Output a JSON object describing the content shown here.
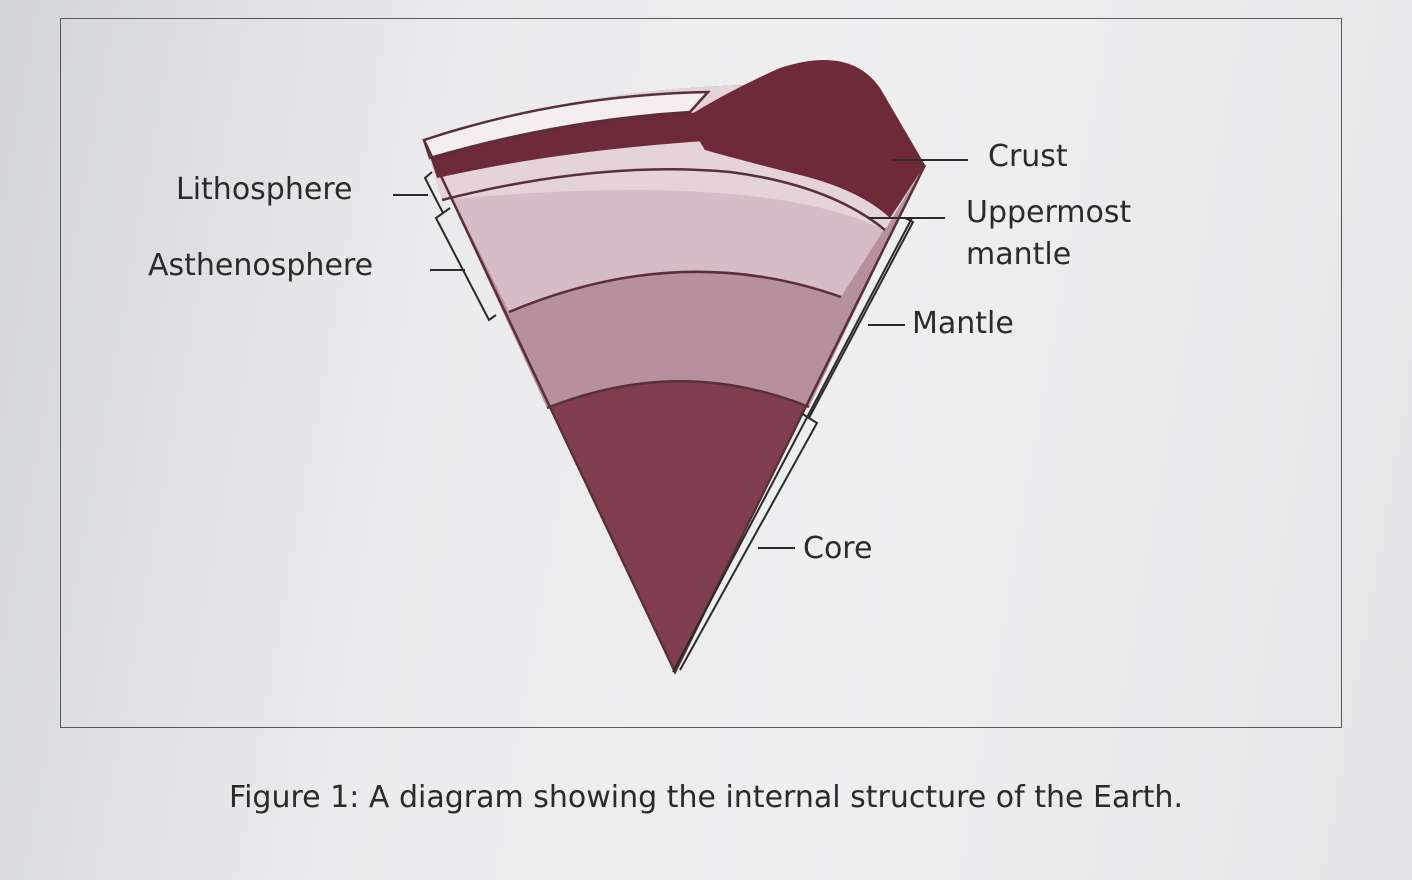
{
  "labels": {
    "crust": "Crust",
    "uppermost_mantle_line1": "Uppermost",
    "uppermost_mantle_line2": "mantle",
    "mantle": "Mantle",
    "core": "Core",
    "lithosphere": "Lithosphere",
    "asthenosphere": "Asthenosphere"
  },
  "caption": "Figure 1: A diagram showing the internal structure of the Earth.",
  "colors": {
    "crust": "#6e2a36",
    "uppermost_mantle": "#e4d3d9",
    "asthenosphere": "#d6bcc6",
    "mantle": "#b7909e",
    "core": "#813e4c",
    "outline": "#5a3038"
  }
}
